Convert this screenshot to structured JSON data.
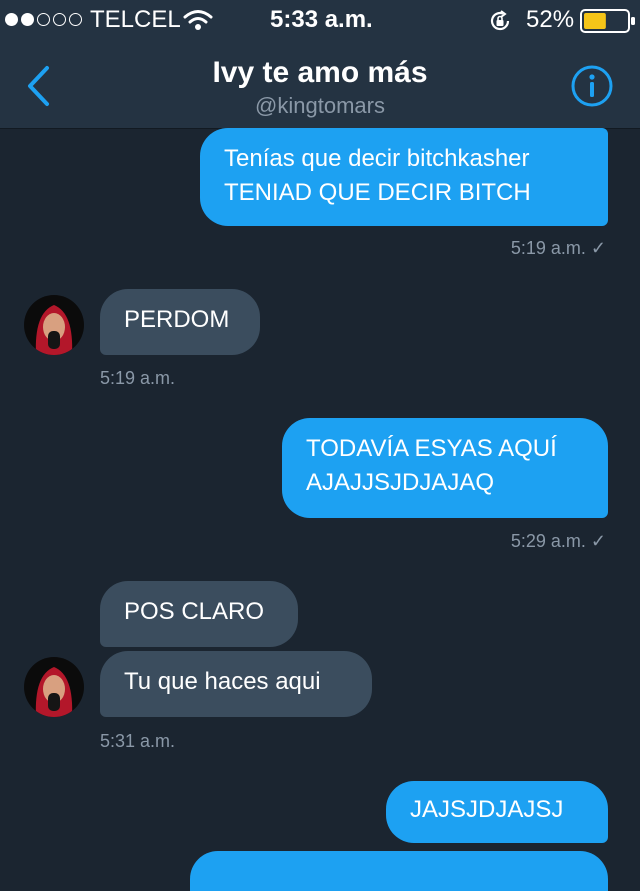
{
  "status_bar": {
    "carrier": "TELCEL",
    "time": "5:33 a.m.",
    "battery": "52%",
    "battery_level": 0.52,
    "signal_bars": 2,
    "signal_total": 5
  },
  "header": {
    "title": "Ivy te amo más",
    "handle": "@kingtomars"
  },
  "messages": [
    {
      "direction": "out",
      "lines": [
        "Tenías que decir bitchkasher",
        "TENIAD QUE DECIR BITCH"
      ],
      "time": "5:19 a.m."
    },
    {
      "direction": "in",
      "lines": [
        "PERDOM"
      ],
      "time": "5:19 a.m."
    },
    {
      "direction": "out",
      "lines": [
        "TODAVÍA ESYAS AQUÍ",
        "AJAJJSJDJAJAQ"
      ],
      "time": "5:29 a.m."
    },
    {
      "direction": "in",
      "lines": [
        "POS CLARO"
      ]
    },
    {
      "direction": "in",
      "lines": [
        "Tu que haces aqui"
      ],
      "time": "5:31 a.m."
    },
    {
      "direction": "out",
      "lines": [
        "JAJSJDJAJSJ"
      ]
    }
  ],
  "colors": {
    "outgoing": "#1da1f2",
    "incoming": "#3b4d5e",
    "background": "#1b2530",
    "header": "#243342",
    "accent": "#1da1f2",
    "battery": "#f5c518"
  },
  "icons": {
    "back": "chevron-left-icon",
    "info": "info-icon",
    "wifi": "wifi-icon",
    "lock": "rotation-lock-icon",
    "battery": "battery-icon",
    "read": "checkmark-icon"
  }
}
